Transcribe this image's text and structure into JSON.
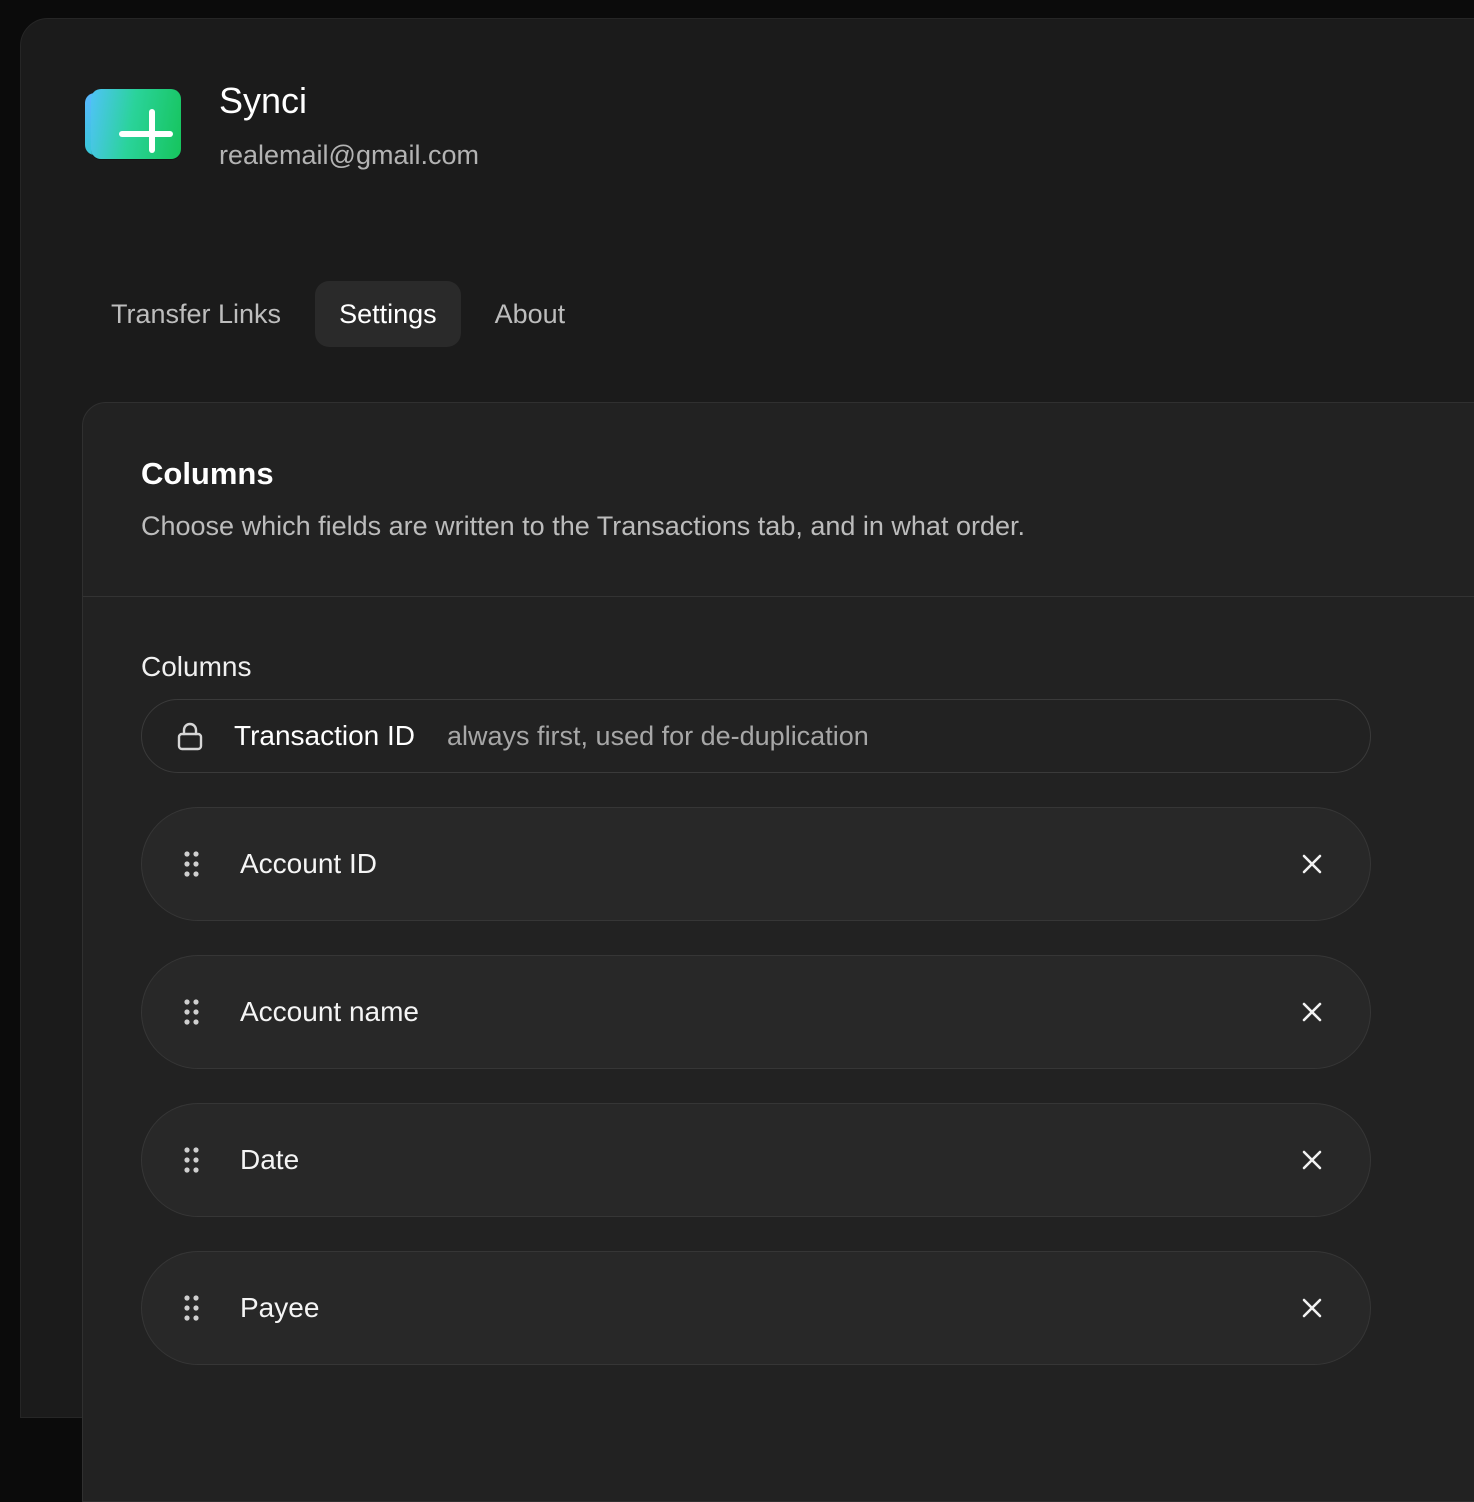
{
  "app": {
    "name": "Synci",
    "email": "realemail@gmail.com",
    "logo_icon": "card-plus-logo"
  },
  "tabs": [
    {
      "label": "Transfer Links",
      "active": false
    },
    {
      "label": "Settings",
      "active": true
    },
    {
      "label": "About",
      "active": false
    }
  ],
  "panel": {
    "title": "Columns",
    "description": "Choose which fields are written to the Transactions tab, and in what order.",
    "section_label": "Columns",
    "locked_column": {
      "icon": "lock-icon",
      "label": "Transaction ID",
      "note": "always first, used for de-duplication"
    },
    "columns": [
      {
        "label": "Account ID"
      },
      {
        "label": "Account name"
      },
      {
        "label": "Date"
      },
      {
        "label": "Payee"
      }
    ]
  },
  "colors": {
    "background": "#1b1b1b",
    "panel": "#222222",
    "row": "#282828",
    "logo_green": "#16c45c",
    "logo_blue": "#4fc3f7"
  }
}
